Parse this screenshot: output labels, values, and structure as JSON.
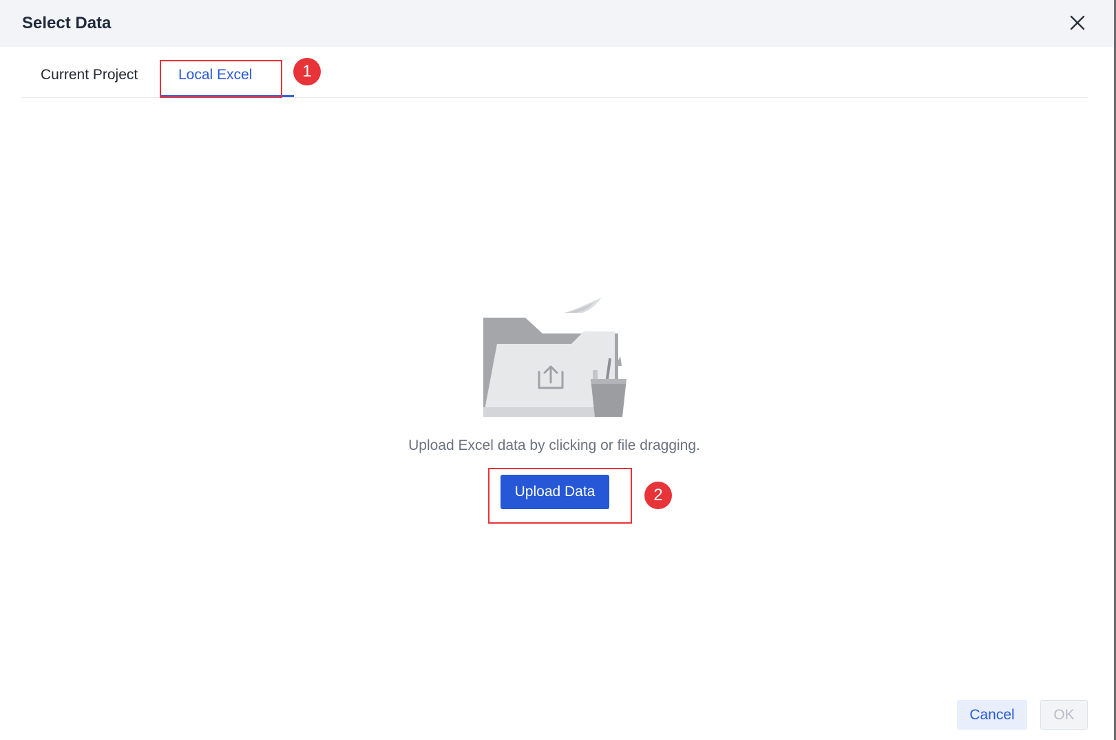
{
  "dialog": {
    "title": "Select Data",
    "close_icon": "close-icon"
  },
  "tabs": [
    {
      "label": "Current Project",
      "active": false
    },
    {
      "label": "Local Excel",
      "active": true
    }
  ],
  "annotations": {
    "step1": "1",
    "step2": "2"
  },
  "upload": {
    "illustration_icon": "folder-upload-illustration",
    "hint": "Upload Excel data by clicking or file dragging.",
    "button_label": "Upload Data"
  },
  "footer": {
    "cancel_label": "Cancel",
    "ok_label": "OK",
    "ok_disabled": true
  },
  "colors": {
    "accent": "#2557d6",
    "annotation_red": "#e83338",
    "header_bg": "#f3f4f7"
  }
}
